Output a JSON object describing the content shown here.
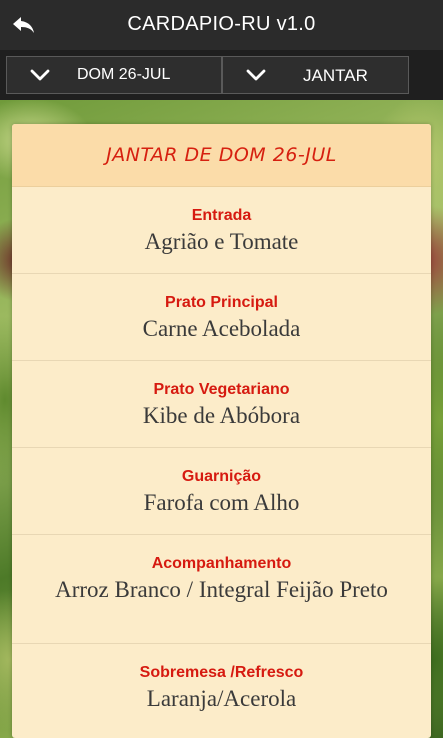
{
  "header": {
    "title": "CARDAPIO-RU v1.0",
    "back_icon": "back-arrow-icon"
  },
  "selectors": {
    "day": "DOM 26-JUL",
    "meal": "JANTAR",
    "chevron_icon": "chevron-down-icon"
  },
  "menu": {
    "title": "JANTAR DE DOM 26-JUL",
    "courses": [
      {
        "category": "Entrada",
        "dish": "Agrião e Tomate"
      },
      {
        "category": "Prato Principal",
        "dish": "Carne Acebolada"
      },
      {
        "category": "Prato Vegetariano",
        "dish": "Kibe de Abóbora"
      },
      {
        "category": "Guarnição",
        "dish": "Farofa com Alho"
      },
      {
        "category": "Acompanhamento",
        "dish": "Arroz Branco / Integral Feijão Preto"
      },
      {
        "category": "Sobremesa /Refresco",
        "dish": "Laranja/Acerola"
      }
    ]
  },
  "colors": {
    "accent_red": "#d61a10",
    "card_bg": "#fcecc9",
    "header_bg": "#fbdca9",
    "topbar_bg": "#2b2b2b"
  }
}
